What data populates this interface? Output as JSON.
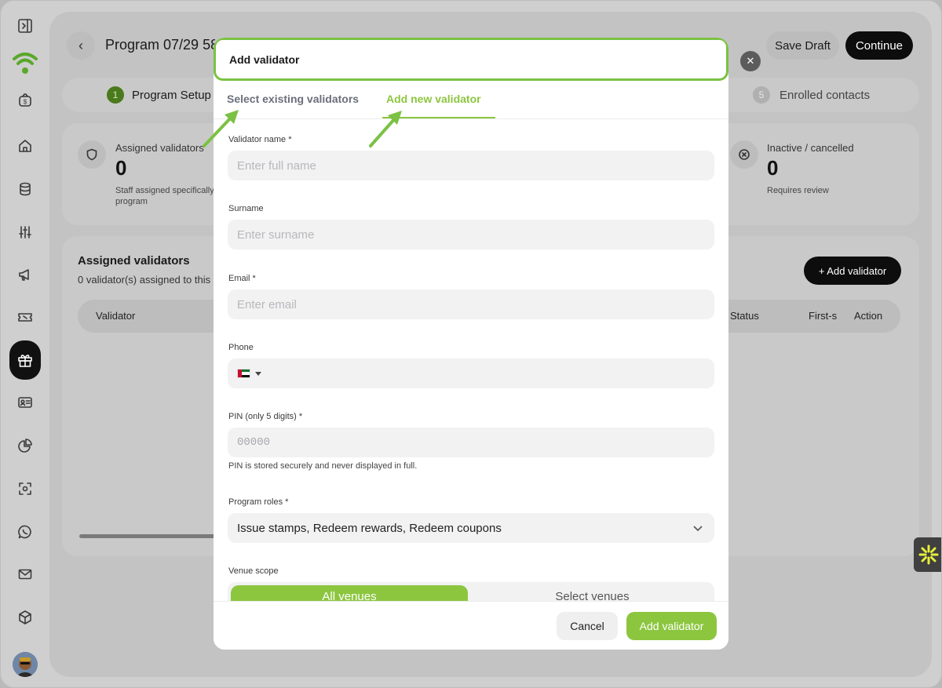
{
  "header": {
    "title": "Program 07/29 58",
    "save_draft": "Save Draft",
    "continue": "Continue"
  },
  "steps": {
    "step1_num": "1",
    "step1_label": "Program Setup",
    "step5_num": "5",
    "step5_label": "Enrolled contacts"
  },
  "stats": {
    "assigned_label": "Assigned validators",
    "assigned_value": "0",
    "assigned_sub": "Staff assigned specifically program",
    "inactive_label": "Inactive / cancelled",
    "inactive_value": "0",
    "inactive_sub": "Requires review"
  },
  "table": {
    "title": "Assigned validators",
    "subtitle": "0 validator(s) assigned to this",
    "add_button": "+ Add validator",
    "columns": [
      "Validator",
      "Status",
      "First-s",
      "Action"
    ]
  },
  "modal": {
    "title": "Add validator",
    "tabs": [
      "Select existing validators",
      "Add new validator"
    ],
    "active_tab": "Add new validator",
    "fields": {
      "name_label": "Validator name *",
      "name_placeholder": "Enter full name",
      "surname_label": "Surname",
      "surname_placeholder": "Enter surname",
      "email_label": "Email *",
      "email_placeholder": "Enter email",
      "phone_label": "Phone",
      "pin_label": "PIN (only 5 digits) *",
      "pin_placeholder": "00000",
      "pin_help": "PIN is stored securely and never displayed in full.",
      "roles_label": "Program roles *",
      "roles_value": "Issue stamps, Redeem rewards, Redeem coupons",
      "venue_label": "Venue scope",
      "venue_all": "All venues",
      "venue_select": "Select venues"
    },
    "cancel": "Cancel",
    "submit": "Add validator"
  },
  "colors": {
    "accent_green": "#8cc63f",
    "highlight_border": "#7bc143",
    "dark_button": "#0d0d0d"
  }
}
